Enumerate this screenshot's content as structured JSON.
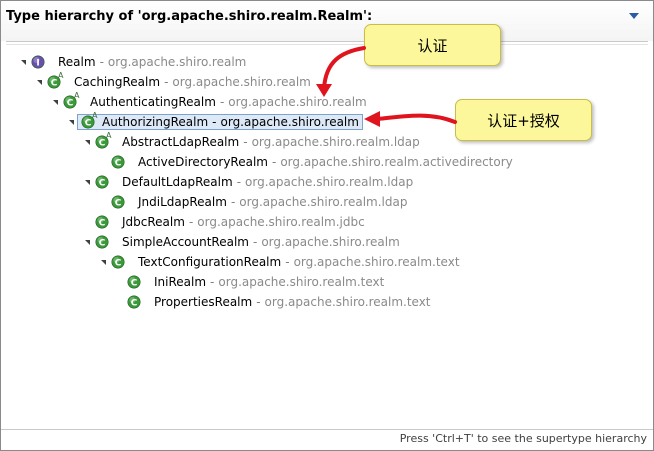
{
  "header": {
    "title": "Type hierarchy of 'org.apache.shiro.realm.Realm':",
    "menu_icon": "view-menu-chevron-icon"
  },
  "tree": [
    {
      "name": "Realm",
      "pkg": "org.apache.shiro.realm",
      "kind": "interface",
      "abstract": false,
      "depth": 0
    },
    {
      "name": "CachingRealm",
      "pkg": "org.apache.shiro.realm",
      "kind": "class",
      "abstract": true,
      "depth": 1
    },
    {
      "name": "AuthenticatingRealm",
      "pkg": "org.apache.shiro.realm",
      "kind": "class",
      "abstract": true,
      "depth": 2
    },
    {
      "name": "AuthorizingRealm",
      "pkg": "org.apache.shiro.realm",
      "kind": "class",
      "abstract": true,
      "depth": 3,
      "selected": true
    },
    {
      "name": "AbstractLdapRealm",
      "pkg": "org.apache.shiro.realm.ldap",
      "kind": "class",
      "abstract": true,
      "depth": 4
    },
    {
      "name": "ActiveDirectoryRealm",
      "pkg": "org.apache.shiro.realm.activedirectory",
      "kind": "class",
      "abstract": false,
      "depth": 5,
      "leaf": true
    },
    {
      "name": "DefaultLdapRealm",
      "pkg": "org.apache.shiro.realm.ldap",
      "kind": "class",
      "abstract": false,
      "depth": 4
    },
    {
      "name": "JndiLdapRealm",
      "pkg": "org.apache.shiro.realm.ldap",
      "kind": "class",
      "abstract": false,
      "depth": 5,
      "leaf": true
    },
    {
      "name": "JdbcRealm",
      "pkg": "org.apache.shiro.realm.jdbc",
      "kind": "class",
      "abstract": false,
      "depth": 4,
      "leaf": true
    },
    {
      "name": "SimpleAccountRealm",
      "pkg": "org.apache.shiro.realm",
      "kind": "class",
      "abstract": false,
      "depth": 4
    },
    {
      "name": "TextConfigurationRealm",
      "pkg": "org.apache.shiro.realm.text",
      "kind": "class",
      "abstract": false,
      "depth": 5
    },
    {
      "name": "IniRealm",
      "pkg": "org.apache.shiro.realm.text",
      "kind": "class",
      "abstract": false,
      "depth": 6,
      "leaf": true
    },
    {
      "name": "PropertiesRealm",
      "pkg": "org.apache.shiro.realm.text",
      "kind": "class",
      "abstract": false,
      "depth": 6,
      "leaf": true
    }
  ],
  "separator": "-",
  "abstract_marker": "A",
  "annotations": [
    {
      "text": "认证"
    },
    {
      "text": "认证+授权"
    }
  ],
  "colors": {
    "arrow": "#e0141e",
    "callout_bg": "#fcf79a",
    "class_icon": "#3a9a3a",
    "interface_icon": "#6a4fb0"
  },
  "footer": {
    "hint": "Press 'Ctrl+T' to see the supertype hierarchy"
  }
}
